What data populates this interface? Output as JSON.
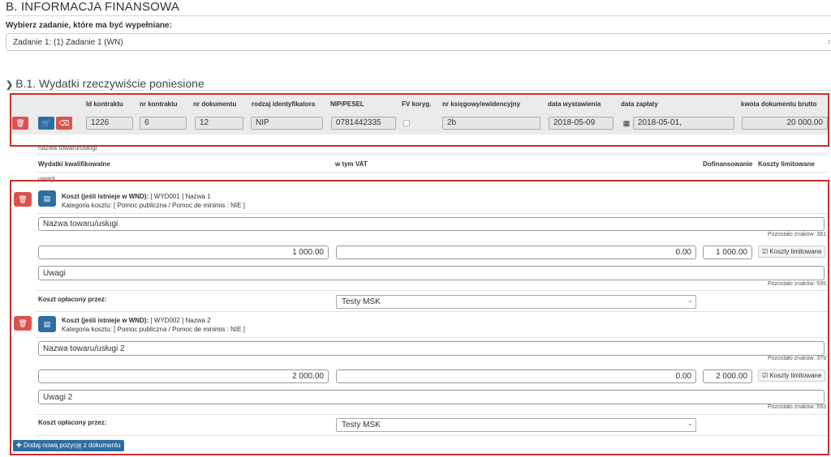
{
  "section": {
    "title": "B. INFORMACJA FINANSOWA"
  },
  "task_select": {
    "label": "Wybierz zadanie, które ma być wypełniane:",
    "value": "Zadanie 1: (1) Zadanie 1 (WN)"
  },
  "b1": {
    "title": "B.1. Wydatki rzeczywiście poniesione"
  },
  "doc_table": {
    "headers": [
      "Id kontraktu",
      "nr kontraktu",
      "nr dokumentu",
      "rodzaj identyfikatora",
      "NIP/PESEL",
      "FV koryg.",
      "nr księgowy/ewidencyjny",
      "data wystawienia",
      "data zapłaty",
      "kwota dokumentu brutto"
    ],
    "row": {
      "id_kontraktu": "1226",
      "nr_kontraktu": "6",
      "nr_dokumentu": "12",
      "rodzaj_identyfikatora": "NIP",
      "nip_pesel": "0781442335",
      "nr_ksiegowy": "2b",
      "data_wystawienia": "2018-05-09",
      "data_zaplaty": "2018-05-01,",
      "kwota_brutto": "20 000.00"
    }
  },
  "subheader": {
    "nazwa_label": "nazwa towaru/usługi",
    "uwagi_label": "uwagi",
    "cols": [
      "Wydatki kwalifikowalne",
      "w tym VAT",
      "Dofinansowanie",
      "Koszty limitowane"
    ]
  },
  "costs": [
    {
      "title_bold": "Koszt (jeśli istnieje w WND):",
      "title_rest": " [ WYD001 ] Nazwa 1",
      "category": "Kategoria kosztu: [ Pomoc publiczna / Pomoc de minimis : NIE ]",
      "name": "Nazwa towaru/usługi",
      "name_remain": "Pozostało znaków: 381",
      "eligible": "1 000.00",
      "vat": "0.00",
      "funding": "1 000.00",
      "limit_label": "Koszty limitowane",
      "remarks": "Uwagi",
      "remarks_remain": "Pozostało znaków: 595",
      "paid_by_label": "Koszt opłacony przez:",
      "paid_by": "Testy MSK"
    },
    {
      "title_bold": "Koszt (jeśli istnieje w WND):",
      "title_rest": " [ WYD002 ] Nazwa 2",
      "category": "Kategoria kosztu: [ Pomoc publiczna / Pomoc de minimis : NIE ]",
      "name": "Nazwa towaru/usługi 2",
      "name_remain": "Pozostało znaków: 379",
      "eligible": "2 000.00",
      "vat": "0.00",
      "funding": "2 000.00",
      "limit_label": "Koszty limitowane",
      "remarks": "Uwagi 2",
      "remarks_remain": "Pozostało znaków: 593",
      "paid_by_label": "Koszt opłacony przez:",
      "paid_by": "Testy MSK"
    }
  ],
  "add_button": {
    "label": "Dodaj nową pozycję z dokumentu"
  },
  "colors": {
    "danger": "#d9534f",
    "primary": "#2e6da4",
    "highlight_box": "#c9302c"
  }
}
